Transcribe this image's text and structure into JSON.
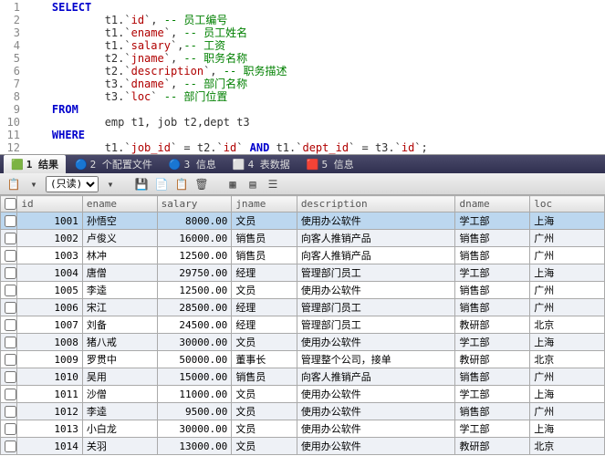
{
  "editor": {
    "lines": [
      {
        "n": 1,
        "i": "    ",
        "t": [
          {
            "k": "kw",
            "s": "SELECT"
          }
        ]
      },
      {
        "n": 2,
        "i": "            ",
        "t": [
          {
            "k": "",
            "s": "t1.`"
          },
          {
            "k": "id",
            "s": "id"
          },
          {
            "k": "",
            "s": "`, "
          },
          {
            "k": "cm",
            "s": "-- 员工编号"
          }
        ]
      },
      {
        "n": 3,
        "i": "            ",
        "t": [
          {
            "k": "",
            "s": "t1.`"
          },
          {
            "k": "id",
            "s": "ename"
          },
          {
            "k": "",
            "s": "`, "
          },
          {
            "k": "cm",
            "s": "-- 员工姓名"
          }
        ]
      },
      {
        "n": 4,
        "i": "            ",
        "t": [
          {
            "k": "",
            "s": "t1.`"
          },
          {
            "k": "id",
            "s": "salary"
          },
          {
            "k": "",
            "s": "`,"
          },
          {
            "k": "cm",
            "s": "-- 工资"
          }
        ]
      },
      {
        "n": 5,
        "i": "            ",
        "t": [
          {
            "k": "",
            "s": "t2.`"
          },
          {
            "k": "id",
            "s": "jname"
          },
          {
            "k": "",
            "s": "`, "
          },
          {
            "k": "cm",
            "s": "-- 职务名称"
          }
        ]
      },
      {
        "n": 6,
        "i": "            ",
        "t": [
          {
            "k": "",
            "s": "t2.`"
          },
          {
            "k": "id",
            "s": "description"
          },
          {
            "k": "",
            "s": "`, "
          },
          {
            "k": "cm",
            "s": "-- 职务描述"
          }
        ]
      },
      {
        "n": 7,
        "i": "            ",
        "t": [
          {
            "k": "",
            "s": "t3.`"
          },
          {
            "k": "id",
            "s": "dname"
          },
          {
            "k": "",
            "s": "`, "
          },
          {
            "k": "cm",
            "s": "-- 部门名称"
          }
        ]
      },
      {
        "n": 8,
        "i": "            ",
        "t": [
          {
            "k": "",
            "s": "t3.`"
          },
          {
            "k": "id",
            "s": "loc"
          },
          {
            "k": "",
            "s": "` "
          },
          {
            "k": "cm",
            "s": "-- 部门位置"
          }
        ]
      },
      {
        "n": 9,
        "i": "    ",
        "t": [
          {
            "k": "kw",
            "s": "FROM"
          }
        ]
      },
      {
        "n": 10,
        "i": "            ",
        "t": [
          {
            "k": "",
            "s": "emp t1, job t2,dept t3"
          }
        ]
      },
      {
        "n": 11,
        "i": "    ",
        "t": [
          {
            "k": "kw",
            "s": "WHERE"
          }
        ]
      },
      {
        "n": 12,
        "i": "            ",
        "t": [
          {
            "k": "",
            "s": "t1.`"
          },
          {
            "k": "id",
            "s": "job_id"
          },
          {
            "k": "",
            "s": "` = t2.`"
          },
          {
            "k": "id",
            "s": "id"
          },
          {
            "k": "",
            "s": "` "
          },
          {
            "k": "kw",
            "s": "AND"
          },
          {
            "k": "",
            "s": " t1.`"
          },
          {
            "k": "id",
            "s": "dept_id"
          },
          {
            "k": "",
            "s": "` = t3.`"
          },
          {
            "k": "id",
            "s": "id"
          },
          {
            "k": "",
            "s": "`;"
          }
        ]
      }
    ]
  },
  "tabs": [
    {
      "icon": "🟩",
      "label": "1 结果",
      "active": true
    },
    {
      "icon": "🔵",
      "label": "2 个配置文件"
    },
    {
      "icon": "🔵",
      "label": "3 信息"
    },
    {
      "icon": "⬜",
      "label": "4 表数据"
    },
    {
      "icon": "🟥",
      "label": "5 信息"
    }
  ],
  "toolbar": {
    "mode": "(只读)",
    "sep": "▼"
  },
  "cols": [
    "id",
    "ename",
    "salary",
    "jname",
    "description",
    "dname",
    "loc"
  ],
  "rows": [
    {
      "id": 1001,
      "ename": "孙悟空",
      "salary": "8000.00",
      "jname": "文员",
      "description": "使用办公软件",
      "dname": "学工部",
      "loc": "上海",
      "sel": true
    },
    {
      "id": 1002,
      "ename": "卢俊义",
      "salary": "16000.00",
      "jname": "销售员",
      "description": "向客人推销产品",
      "dname": "销售部",
      "loc": "广州"
    },
    {
      "id": 1003,
      "ename": "林冲",
      "salary": "12500.00",
      "jname": "销售员",
      "description": "向客人推销产品",
      "dname": "销售部",
      "loc": "广州"
    },
    {
      "id": 1004,
      "ename": "唐僧",
      "salary": "29750.00",
      "jname": "经理",
      "description": "管理部门员工",
      "dname": "学工部",
      "loc": "上海"
    },
    {
      "id": 1005,
      "ename": "李逵",
      "salary": "12500.00",
      "jname": "文员",
      "description": "使用办公软件",
      "dname": "销售部",
      "loc": "广州"
    },
    {
      "id": 1006,
      "ename": "宋江",
      "salary": "28500.00",
      "jname": "经理",
      "description": "管理部门员工",
      "dname": "销售部",
      "loc": "广州"
    },
    {
      "id": 1007,
      "ename": "刘备",
      "salary": "24500.00",
      "jname": "经理",
      "description": "管理部门员工",
      "dname": "教研部",
      "loc": "北京"
    },
    {
      "id": 1008,
      "ename": "猪八戒",
      "salary": "30000.00",
      "jname": "文员",
      "description": "使用办公软件",
      "dname": "学工部",
      "loc": "上海"
    },
    {
      "id": 1009,
      "ename": "罗贯中",
      "salary": "50000.00",
      "jname": "董事长",
      "description": "管理整个公司，接单",
      "dname": "教研部",
      "loc": "北京"
    },
    {
      "id": 1010,
      "ename": "吴用",
      "salary": "15000.00",
      "jname": "销售员",
      "description": "向客人推销产品",
      "dname": "销售部",
      "loc": "广州"
    },
    {
      "id": 1011,
      "ename": "沙僧",
      "salary": "11000.00",
      "jname": "文员",
      "description": "使用办公软件",
      "dname": "学工部",
      "loc": "上海"
    },
    {
      "id": 1012,
      "ename": "李逵",
      "salary": "9500.00",
      "jname": "文员",
      "description": "使用办公软件",
      "dname": "销售部",
      "loc": "广州"
    },
    {
      "id": 1013,
      "ename": "小白龙",
      "salary": "30000.00",
      "jname": "文员",
      "description": "使用办公软件",
      "dname": "学工部",
      "loc": "上海"
    },
    {
      "id": 1014,
      "ename": "关羽",
      "salary": "13000.00",
      "jname": "文员",
      "description": "使用办公软件",
      "dname": "教研部",
      "loc": "北京"
    }
  ]
}
